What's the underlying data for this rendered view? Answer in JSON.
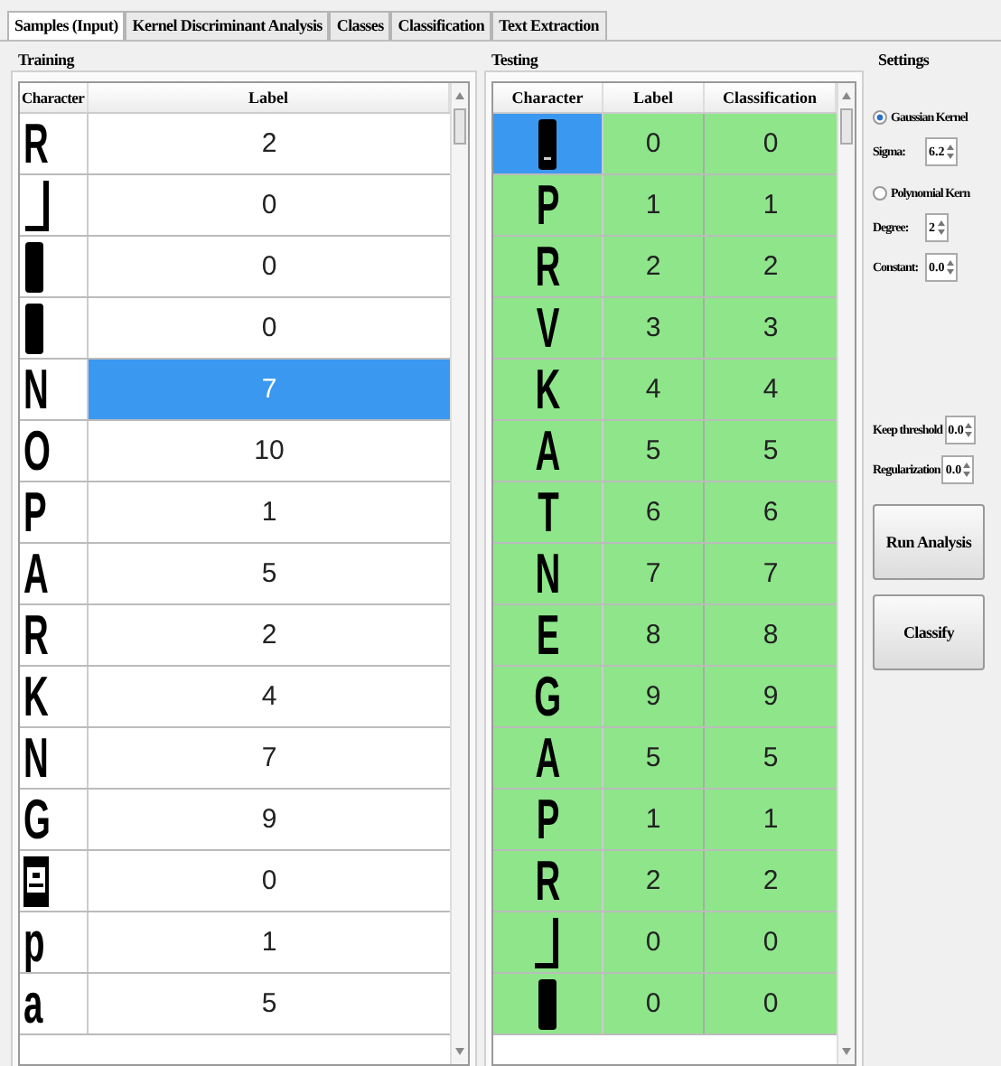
{
  "tabs": [
    {
      "label": "Samples (Input)",
      "selected": true
    },
    {
      "label": "Kernel Discriminant Analysis",
      "selected": false
    },
    {
      "label": "Classes",
      "selected": false
    },
    {
      "label": "Classification",
      "selected": false
    },
    {
      "label": "Text Extraction",
      "selected": false
    }
  ],
  "training": {
    "title": "Training",
    "columns": [
      "Character",
      "Label"
    ],
    "rows": [
      {
        "character": {
          "kind": "letter",
          "glyph": "R"
        },
        "label": "2",
        "selected": false
      },
      {
        "character": {
          "kind": "corner"
        },
        "label": "0",
        "selected": false
      },
      {
        "character": {
          "kind": "blob"
        },
        "label": "0",
        "selected": false
      },
      {
        "character": {
          "kind": "blob"
        },
        "label": "0",
        "selected": false
      },
      {
        "character": {
          "kind": "letter",
          "glyph": "N"
        },
        "label": "7",
        "selected": true
      },
      {
        "character": {
          "kind": "letter",
          "glyph": "O"
        },
        "label": "10",
        "selected": false
      },
      {
        "character": {
          "kind": "letter",
          "glyph": "P"
        },
        "label": "1",
        "selected": false
      },
      {
        "character": {
          "kind": "letter",
          "glyph": "A"
        },
        "label": "5",
        "selected": false
      },
      {
        "character": {
          "kind": "letter",
          "glyph": "R"
        },
        "label": "2",
        "selected": false
      },
      {
        "character": {
          "kind": "letter",
          "glyph": "K"
        },
        "label": "4",
        "selected": false
      },
      {
        "character": {
          "kind": "letter",
          "glyph": "N"
        },
        "label": "7",
        "selected": false
      },
      {
        "character": {
          "kind": "letter",
          "glyph": "G"
        },
        "label": "9",
        "selected": false
      },
      {
        "character": {
          "kind": "boxed"
        },
        "label": "0",
        "selected": false
      },
      {
        "character": {
          "kind": "letter",
          "glyph": "p"
        },
        "label": "1",
        "selected": false
      },
      {
        "character": {
          "kind": "letter",
          "glyph": "a"
        },
        "label": "5",
        "selected": false
      }
    ]
  },
  "testing": {
    "title": "Testing",
    "columns": [
      "Character",
      "Label",
      "Classification"
    ],
    "rows": [
      {
        "character": {
          "kind": "blob"
        },
        "label": "0",
        "classification": "0",
        "selected": true,
        "correct": true
      },
      {
        "character": {
          "kind": "letter",
          "glyph": "P"
        },
        "label": "1",
        "classification": "1",
        "selected": false,
        "correct": true
      },
      {
        "character": {
          "kind": "letter",
          "glyph": "R"
        },
        "label": "2",
        "classification": "2",
        "selected": false,
        "correct": true
      },
      {
        "character": {
          "kind": "letter",
          "glyph": "V"
        },
        "label": "3",
        "classification": "3",
        "selected": false,
        "correct": true
      },
      {
        "character": {
          "kind": "letter",
          "glyph": "K"
        },
        "label": "4",
        "classification": "4",
        "selected": false,
        "correct": true
      },
      {
        "character": {
          "kind": "letter",
          "glyph": "A"
        },
        "label": "5",
        "classification": "5",
        "selected": false,
        "correct": true
      },
      {
        "character": {
          "kind": "letter",
          "glyph": "T"
        },
        "label": "6",
        "classification": "6",
        "selected": false,
        "correct": true
      },
      {
        "character": {
          "kind": "letter",
          "glyph": "N"
        },
        "label": "7",
        "classification": "7",
        "selected": false,
        "correct": true
      },
      {
        "character": {
          "kind": "letter",
          "glyph": "E"
        },
        "label": "8",
        "classification": "8",
        "selected": false,
        "correct": true
      },
      {
        "character": {
          "kind": "letter",
          "glyph": "G"
        },
        "label": "9",
        "classification": "9",
        "selected": false,
        "correct": true
      },
      {
        "character": {
          "kind": "letter",
          "glyph": "A"
        },
        "label": "5",
        "classification": "5",
        "selected": false,
        "correct": true
      },
      {
        "character": {
          "kind": "letter",
          "glyph": "P"
        },
        "label": "1",
        "classification": "1",
        "selected": false,
        "correct": true
      },
      {
        "character": {
          "kind": "letter",
          "glyph": "R"
        },
        "label": "2",
        "classification": "2",
        "selected": false,
        "correct": true
      },
      {
        "character": {
          "kind": "corner"
        },
        "label": "0",
        "classification": "0",
        "selected": false,
        "correct": true
      },
      {
        "character": {
          "kind": "blob"
        },
        "label": "0",
        "classification": "0",
        "selected": false,
        "correct": true
      }
    ]
  },
  "settings": {
    "title": "Settings",
    "kernels": [
      {
        "label": "Gaussian Kernel",
        "selected": true,
        "fields": [
          {
            "label": "Sigma:",
            "value": "6.2"
          }
        ]
      },
      {
        "label": "Polynomial Kern",
        "selected": false,
        "fields": [
          {
            "label": "Degree:",
            "value": "2"
          },
          {
            "label": "Constant:",
            "value": "0.0"
          }
        ]
      }
    ],
    "options": [
      {
        "label": "Keep threshold",
        "value": "0.0"
      },
      {
        "label": "Regularization",
        "value": "0.0"
      }
    ],
    "buttons": [
      "Run Analysis",
      "Classify"
    ]
  }
}
